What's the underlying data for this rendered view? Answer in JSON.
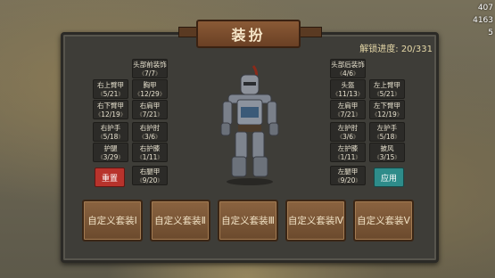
{
  "hud": {
    "top_value": "407",
    "second_value": "4163",
    "third_value": "5"
  },
  "title": "装扮",
  "progress": {
    "label": "解锁进度:",
    "value": "20/331"
  },
  "left_slots": [
    {
      "name": "头部前装饰",
      "value": "7/7"
    },
    {
      "name": "右上臂甲",
      "value": "5/21"
    },
    {
      "name": "胸甲",
      "value": "12/29"
    },
    {
      "name": "右下臂甲",
      "value": "12/19"
    },
    {
      "name": "右肩甲",
      "value": "7/21"
    },
    {
      "name": "右护手",
      "value": "5/18"
    },
    {
      "name": "右护肘",
      "value": "3/6"
    },
    {
      "name": "护腿",
      "value": "3/29"
    },
    {
      "name": "右护膝",
      "value": "1/11"
    },
    {
      "name": "右腿甲",
      "value": "9/20"
    }
  ],
  "right_slots": [
    {
      "name": "头部后装饰",
      "value": "4/6"
    },
    {
      "name": "头盔",
      "value": "11/13"
    },
    {
      "name": "左上臂甲",
      "value": "5/21"
    },
    {
      "name": "左肩甲",
      "value": "7/21"
    },
    {
      "name": "左下臂甲",
      "value": "12/19"
    },
    {
      "name": "左护肘",
      "value": "3/6"
    },
    {
      "name": "左护手",
      "value": "5/18"
    },
    {
      "name": "左护膝",
      "value": "1/11"
    },
    {
      "name": "披风",
      "value": "3/15"
    },
    {
      "name": "左腿甲",
      "value": "9/20"
    }
  ],
  "reset_label": "重置",
  "apply_label": "应用",
  "outfits": [
    "自定义套装Ⅰ",
    "自定义套装Ⅱ",
    "自定义套装Ⅲ",
    "自定义套装Ⅳ",
    "自定义套装Ⅴ"
  ],
  "colors": {
    "reset": "#b8332c",
    "apply": "#2e8c8a",
    "title_plate": "#7a4c2c"
  }
}
